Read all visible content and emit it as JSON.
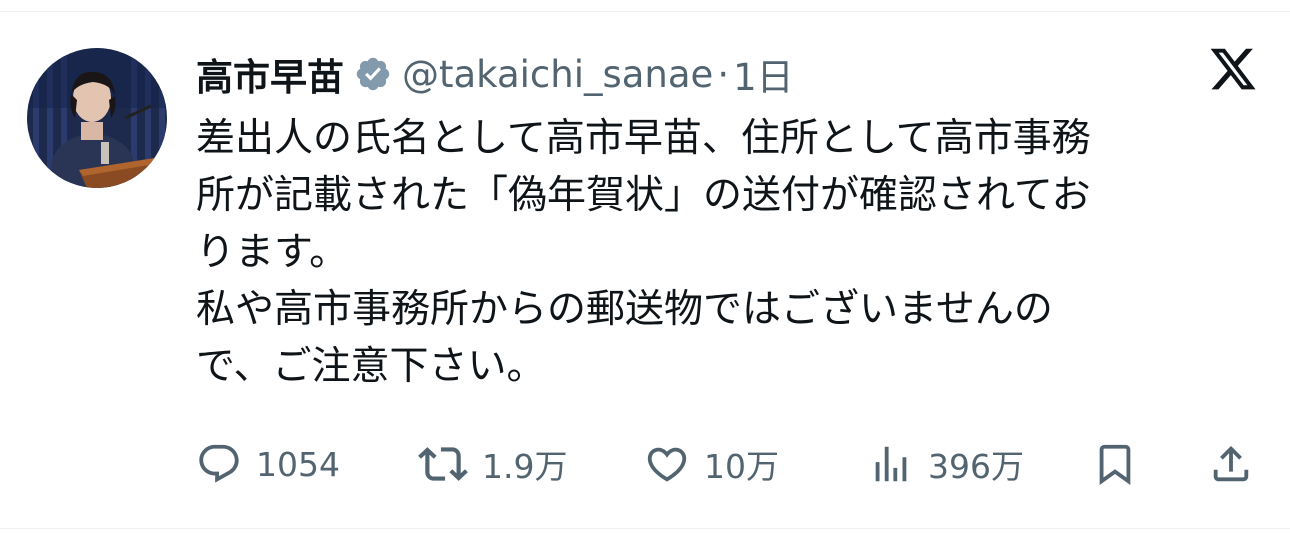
{
  "author": {
    "display_name": "高市早苗",
    "handle": "@takaichi_sanae",
    "separator": "·",
    "time": "1日",
    "avatar_icon": "profile-photo",
    "verified_icon": "verified-badge-icon",
    "verified_color": "#829aab"
  },
  "platform_icon": "x-logo-icon",
  "tweet": {
    "lines": [
      "差出人の氏名として高市早苗、住所として高市事務",
      "所が記載された「偽年賀状」の送付が確認されてお",
      "ります。",
      "私や高市事務所からの郵送物ではございませんの",
      "で、ご注意下さい。"
    ]
  },
  "actions": {
    "reply": {
      "icon": "reply-icon",
      "count": "1054"
    },
    "retweet": {
      "icon": "retweet-icon",
      "count": "1.9万"
    },
    "like": {
      "icon": "heart-icon",
      "count": "10万"
    },
    "views": {
      "icon": "views-icon",
      "count": "396万"
    },
    "bookmark": {
      "icon": "bookmark-icon"
    },
    "share": {
      "icon": "share-icon"
    }
  },
  "colors": {
    "text_primary": "#0f1419",
    "text_secondary": "#536471",
    "divider": "#eff3f4"
  }
}
